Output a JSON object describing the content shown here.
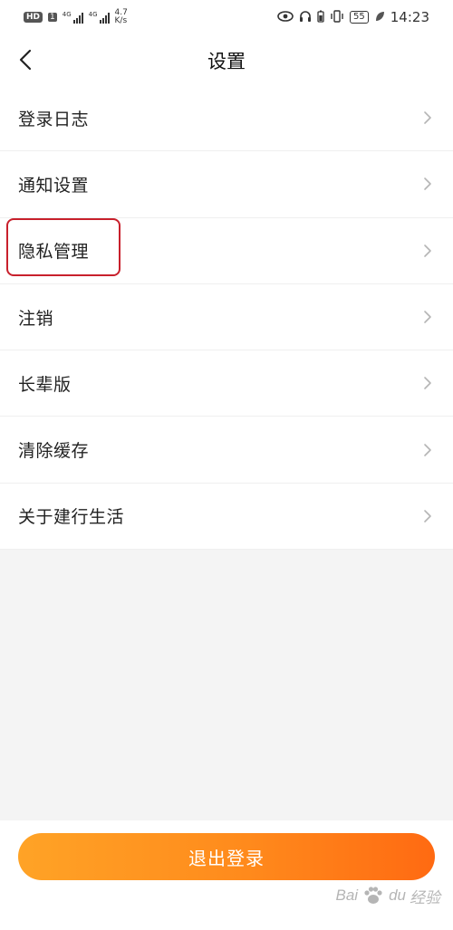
{
  "status_bar": {
    "hd": "HD",
    "sim": "1",
    "gen1": "4G",
    "gen2": "4G",
    "speed_value": "4.7",
    "speed_unit": "K/s",
    "battery": "55",
    "time": "14:23"
  },
  "header": {
    "title": "设置"
  },
  "settings": {
    "items": [
      {
        "label": "登录日志"
      },
      {
        "label": "通知设置"
      },
      {
        "label": "隐私管理",
        "highlighted": true
      },
      {
        "label": "注销"
      },
      {
        "label": "长辈版"
      },
      {
        "label": "清除缓存"
      },
      {
        "label": "关于建行生活"
      }
    ]
  },
  "footer": {
    "logout_label": "退出登录"
  },
  "watermark": {
    "brand_left": "Bai",
    "brand_right": "du",
    "suffix": "经验"
  },
  "colors": {
    "accent_start": "#ffa326",
    "accent_end": "#ff6a12",
    "highlight": "#c8202c"
  }
}
